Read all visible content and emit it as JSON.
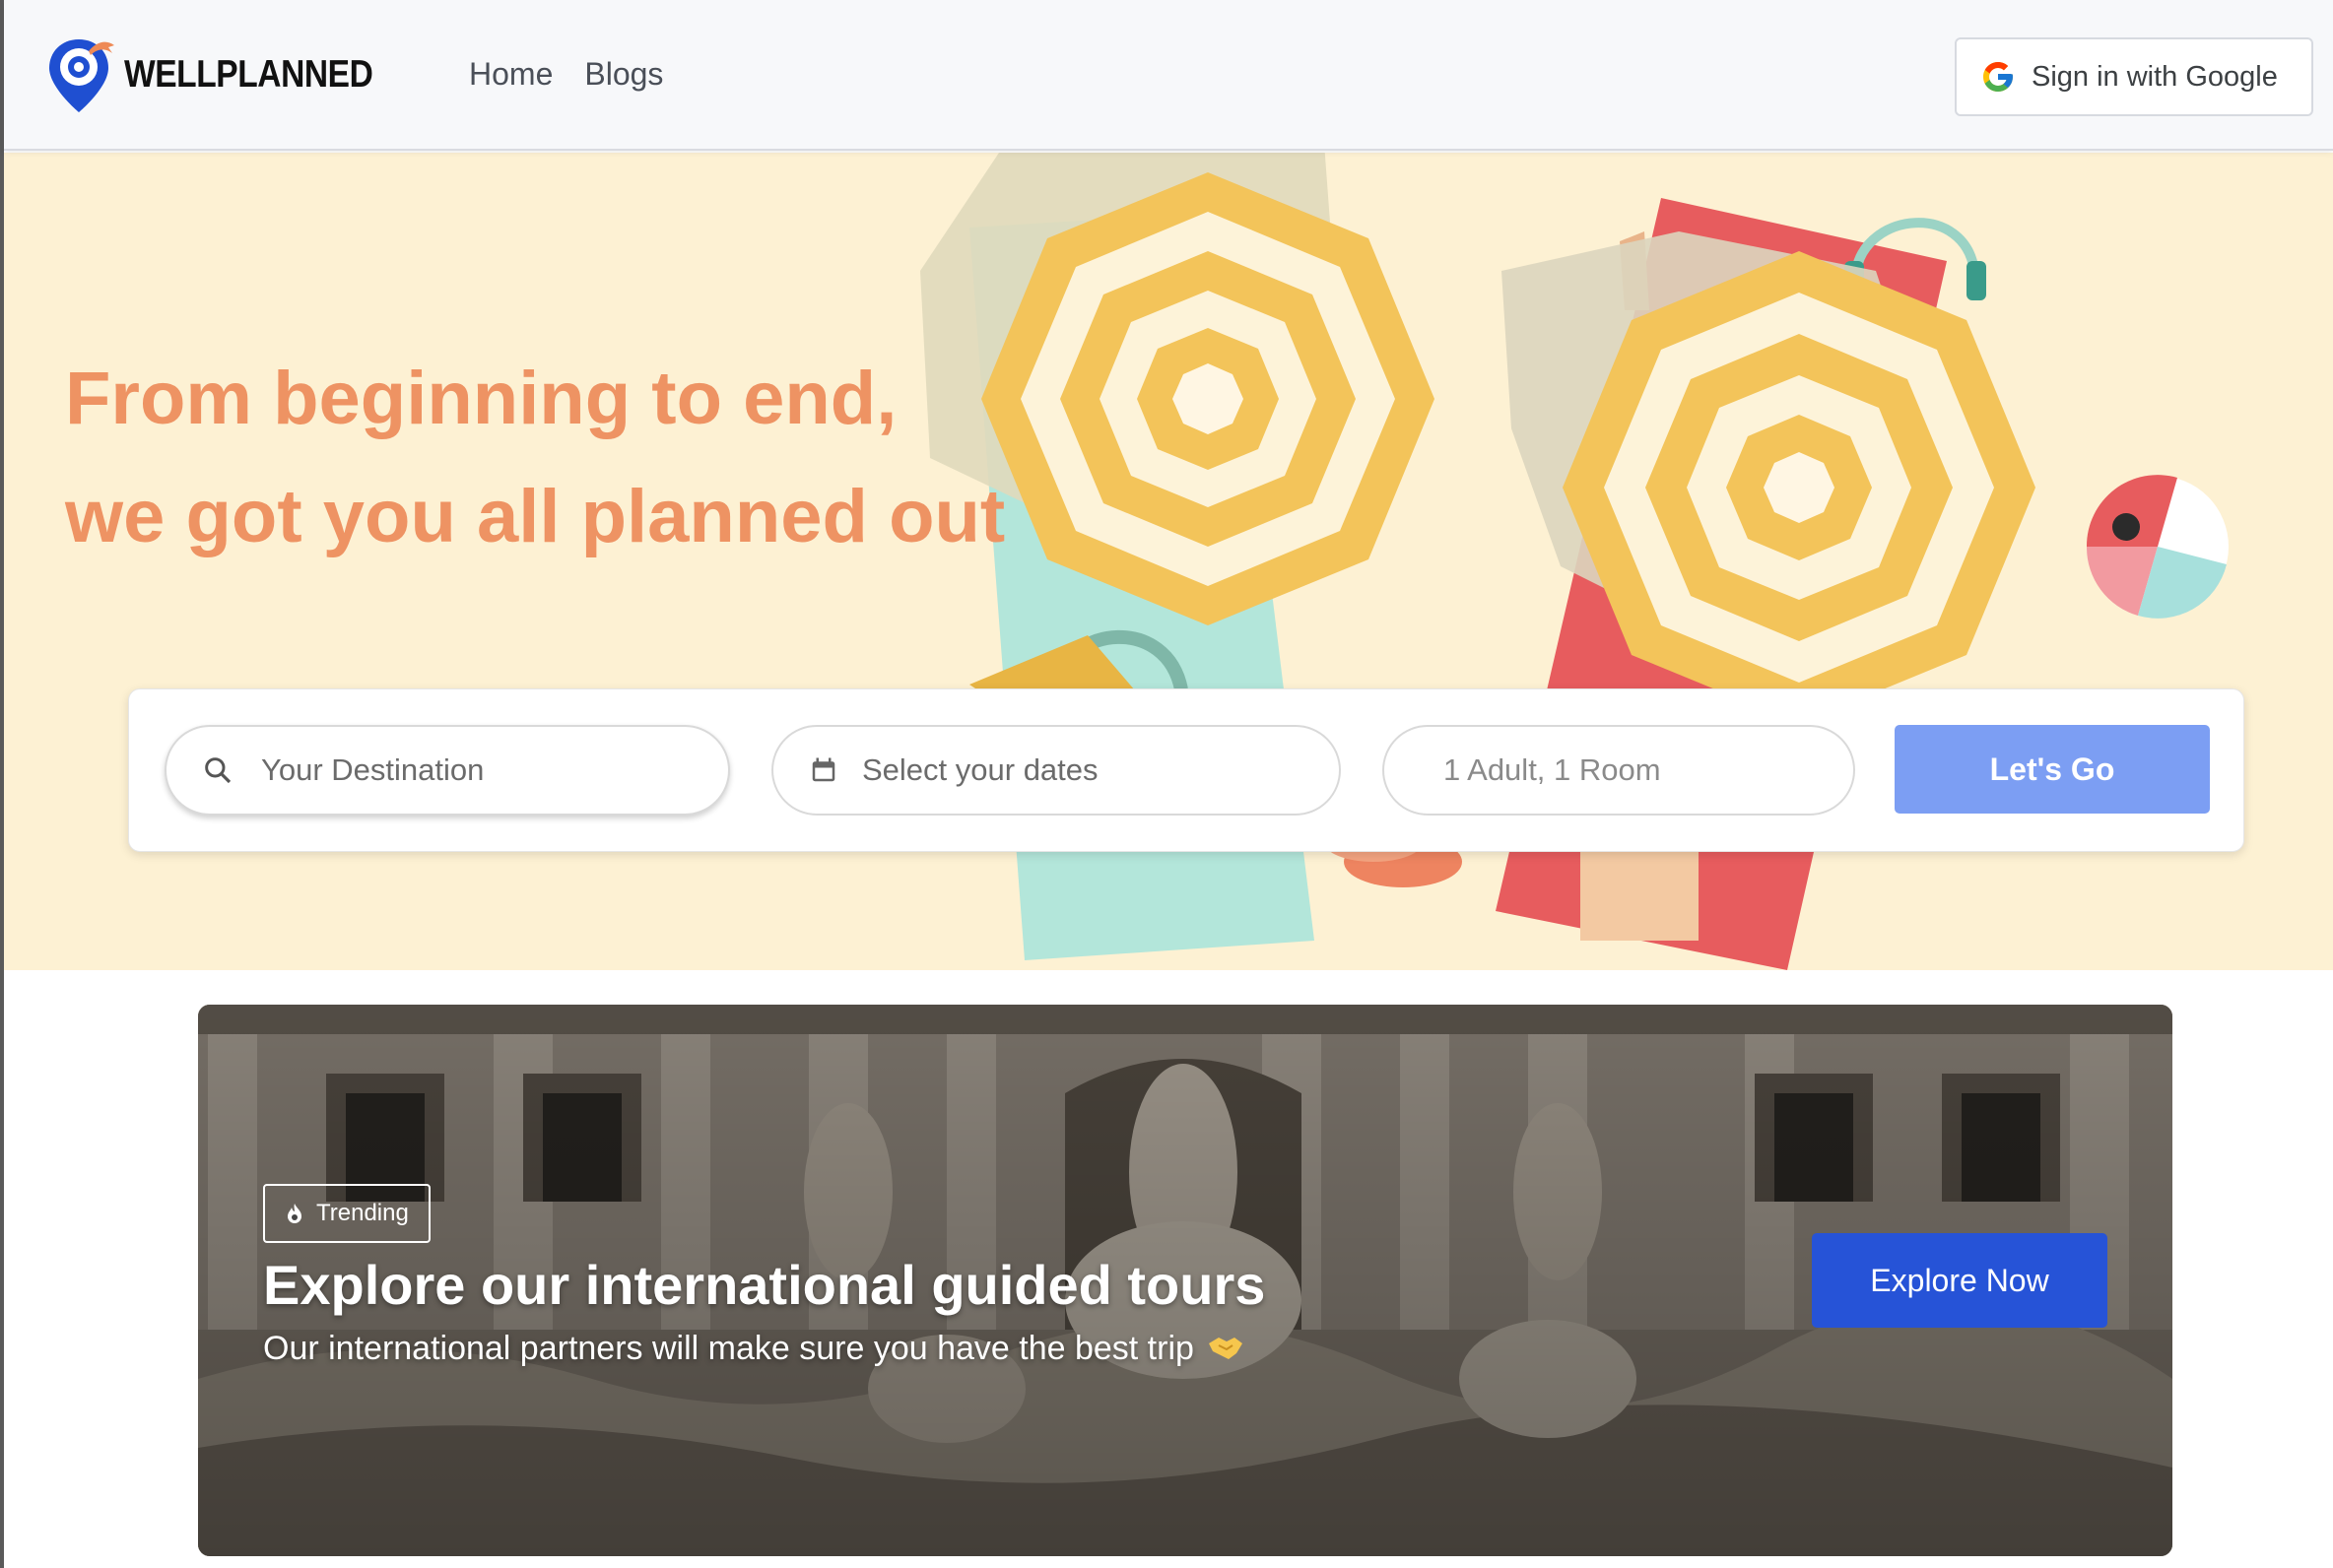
{
  "brand": {
    "name": "WELLPLANNED",
    "logo_icon": "map-pin-icon"
  },
  "nav": {
    "items": [
      {
        "label": "Home"
      },
      {
        "label": "Blogs"
      }
    ]
  },
  "auth": {
    "google_label": "Sign in with Google",
    "icon": "google-icon"
  },
  "hero": {
    "headline_line1": "From beginning to end,",
    "headline_line2": "we got you all planned out",
    "accent_color": "#ee9363",
    "background_color": "#fdf1d3"
  },
  "search": {
    "destination": {
      "placeholder": "Your Destination",
      "icon": "search-icon"
    },
    "dates": {
      "placeholder": "Select your dates",
      "icon": "calendar-icon"
    },
    "guests": {
      "value": "1 Adult, 1 Room"
    },
    "submit_label": "Let's Go",
    "submit_color": "#7c9ef3"
  },
  "banner": {
    "badge_label": "Trending",
    "badge_icon": "flame-icon",
    "title": "Explore our international guided tours",
    "subtitle": "Our international partners will make sure you have the best trip",
    "subtitle_icon": "handshake-icon",
    "cta_label": "Explore Now",
    "cta_color": "#2653d7"
  }
}
